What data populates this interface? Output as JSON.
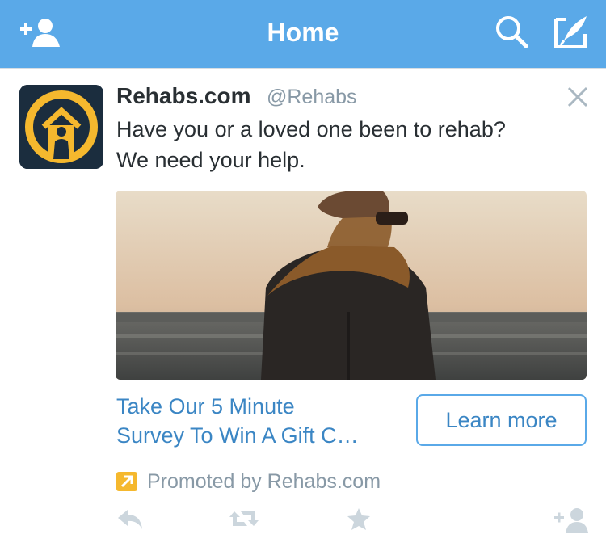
{
  "navbar": {
    "title": "Home",
    "color": "#5aa9e8",
    "icons": [
      "add-user-icon",
      "search-icon",
      "compose-icon"
    ]
  },
  "tweet": {
    "author_name": "Rehabs.com",
    "author_handle": "@Rehabs",
    "text_line1": "Have you or a loved one been to rehab?",
    "text_line2": "We need your help.",
    "card": {
      "title_line1": "Take Our 5 Minute",
      "title_line2": "Survey To Win A Gift C…",
      "cta_label": "Learn more"
    },
    "promoted_label": "Promoted by Rehabs.com",
    "actions": [
      "reply-icon",
      "retweet-icon",
      "favorite-icon",
      "follow-icon"
    ],
    "colors": {
      "link": "#3b86c4",
      "muted": "#8899a6",
      "promoted_badge": "#f5b82e",
      "avatar_bg": "#1b2d3e"
    }
  }
}
